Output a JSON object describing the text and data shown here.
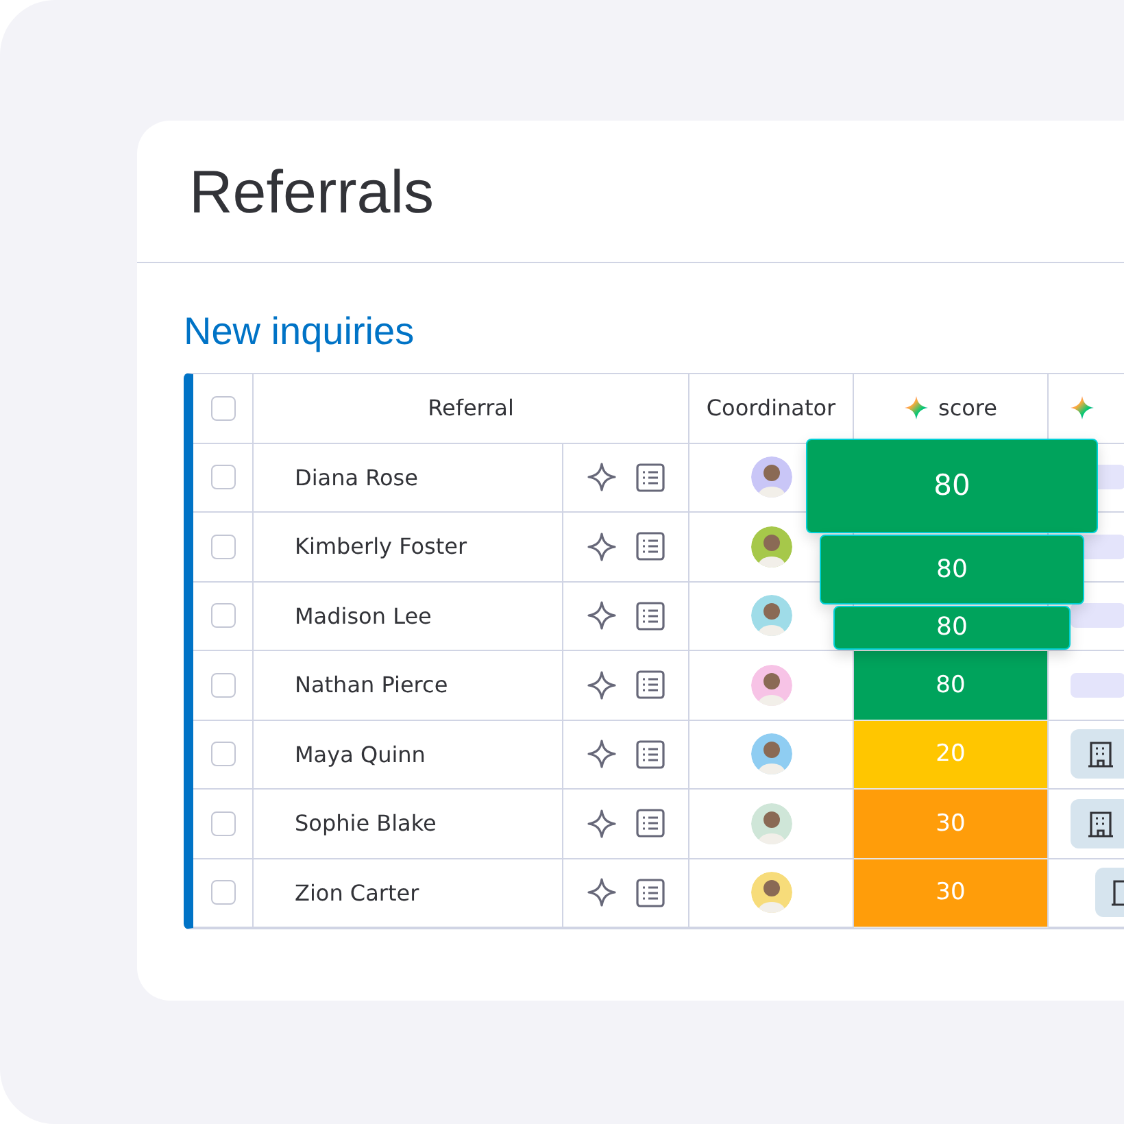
{
  "page_title": "Referrals",
  "group": {
    "title": "New inquiries",
    "color": "#0073c6"
  },
  "table": {
    "columns": [
      "Referral",
      "Coordinator",
      "score"
    ],
    "all_checked": false,
    "rows": [
      {
        "name": "Diana Rose",
        "checked": false,
        "avatar": {
          "color": "#c9c6f7"
        },
        "score": {
          "text": "80",
          "color": "#00a35c",
          "lifted": true
        },
        "column_6": {
          "kind": "pill"
        }
      },
      {
        "name": "Kimberly Foster",
        "checked": false,
        "avatar": {
          "color": "#a6c84a"
        },
        "score": {
          "text": "80",
          "color": "#00a35c",
          "lifted": true
        },
        "column_6": {
          "kind": "pill"
        }
      },
      {
        "name": "Madison Lee",
        "checked": false,
        "avatar": {
          "color": "#9fdce8"
        },
        "score": {
          "text": "80",
          "color": "#00a35c",
          "lifted": true
        },
        "column_6": {
          "kind": "pill"
        }
      },
      {
        "name": "Nathan Pierce",
        "checked": false,
        "avatar": {
          "color": "#f7c3e6"
        },
        "score": {
          "text": "80",
          "color": "#00a35c",
          "lifted": false
        },
        "column_6": {
          "kind": "pill"
        }
      },
      {
        "name": "Maya Quinn",
        "checked": false,
        "avatar": {
          "color": "#8fcdf2"
        },
        "score": {
          "text": "20",
          "color": "#ffc600",
          "lifted": false
        },
        "column_6": {
          "kind": "building"
        }
      },
      {
        "name": "Sophie Blake",
        "checked": false,
        "avatar": {
          "color": "#cfe6d8"
        },
        "score": {
          "text": "30",
          "color": "#ff9d0a",
          "lifted": false
        },
        "column_6": {
          "kind": "building"
        }
      },
      {
        "name": "Zion Carter",
        "checked": false,
        "avatar": {
          "color": "#f7dc7a"
        },
        "score": {
          "text": "30",
          "color": "#ff9d0a",
          "lifted": false
        },
        "column_6": {
          "kind": "building-cut"
        }
      }
    ]
  }
}
